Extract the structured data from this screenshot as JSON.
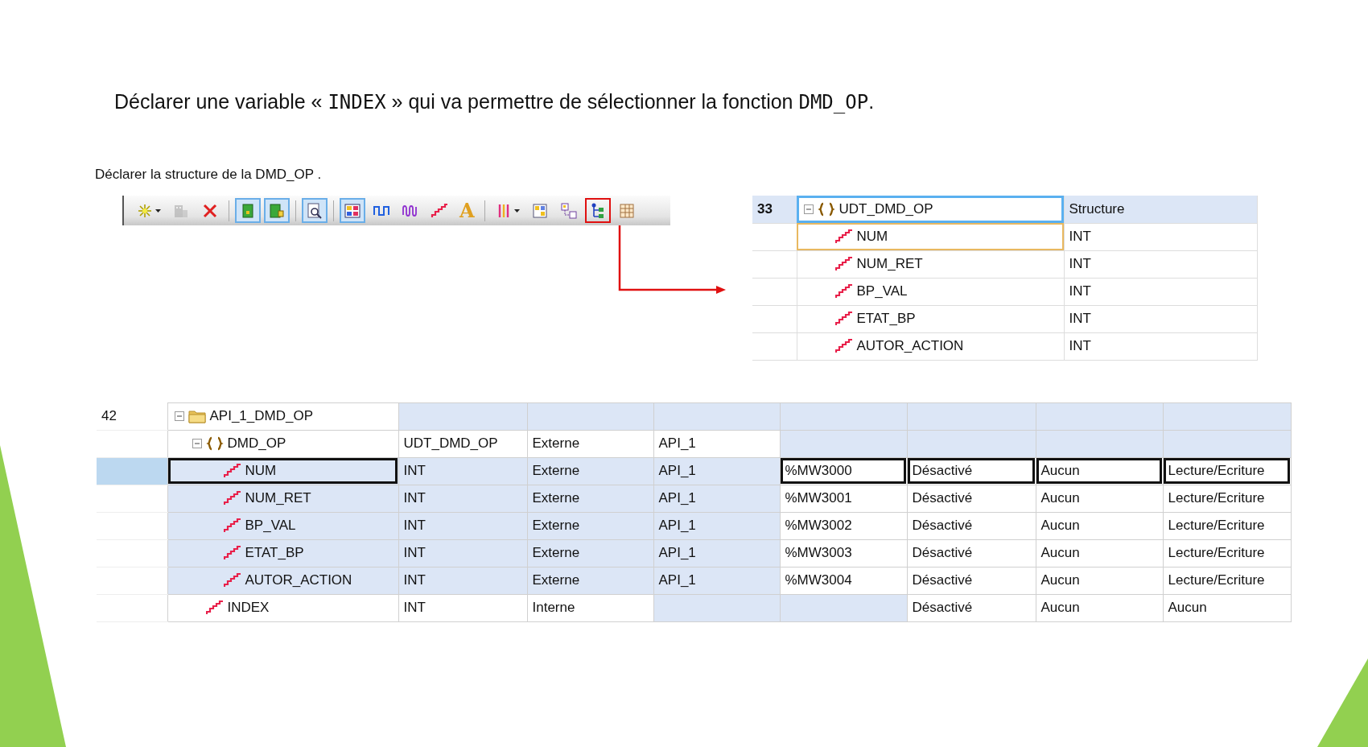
{
  "heading": [
    {
      "kind": "plain",
      "text": "Déclarer une variable « "
    },
    {
      "kind": "code",
      "text": "INDEX"
    },
    {
      "kind": "plain",
      "text": " » qui va permettre de sélectionner la fonction "
    },
    {
      "kind": "code",
      "text": "DMD_OP"
    },
    {
      "kind": "plain",
      "text": "."
    }
  ],
  "subtitle": "Déclarer la structure de la DMD_OP .",
  "toolbar": [
    {
      "kind": "sparkle",
      "pressed": false,
      "caret": true,
      "highlighted": false
    },
    {
      "kind": "building",
      "pressed": false,
      "caret": false,
      "highlighted": false
    },
    {
      "kind": "delete",
      "pressed": false,
      "caret": false,
      "highlighted": false
    },
    {
      "kind": "separator"
    },
    {
      "kind": "green-box",
      "pressed": true,
      "caret": false,
      "highlighted": false
    },
    {
      "kind": "green-box-plug",
      "pressed": true,
      "caret": false,
      "highlighted": false
    },
    {
      "kind": "separator"
    },
    {
      "kind": "magnifier",
      "pressed": true,
      "caret": false,
      "highlighted": false
    },
    {
      "kind": "separator"
    },
    {
      "kind": "color-grid",
      "pressed": true,
      "caret": false,
      "highlighted": false
    },
    {
      "kind": "square-wave",
      "pressed": false,
      "caret": false,
      "highlighted": false
    },
    {
      "kind": "wave",
      "pressed": false,
      "caret": false,
      "highlighted": false
    },
    {
      "kind": "staircase",
      "pressed": false,
      "caret": false,
      "highlighted": false
    },
    {
      "kind": "letter",
      "text": "A",
      "pressed": false,
      "caret": false,
      "highlighted": false
    },
    {
      "kind": "separator"
    },
    {
      "kind": "columns",
      "pressed": false,
      "caret": true,
      "highlighted": false
    },
    {
      "kind": "yellow-grid",
      "pressed": false,
      "caret": false,
      "highlighted": false
    },
    {
      "kind": "hierarchy",
      "pressed": false,
      "caret": false,
      "highlighted": false
    },
    {
      "kind": "tree",
      "pressed": false,
      "caret": false,
      "highlighted": true
    },
    {
      "kind": "table",
      "pressed": false,
      "caret": false,
      "highlighted": false
    }
  ],
  "structure_table": {
    "rows": [
      {
        "number": "33",
        "selected": true,
        "focused": true,
        "hovered": false,
        "kind": "structure",
        "expanded": true,
        "name": "UDT_DMD_OP",
        "type": "Structure",
        "children": [
          {
            "selected": false,
            "focused": false,
            "hovered": true,
            "kind": "variable",
            "name": "NUM",
            "type": "INT"
          },
          {
            "selected": false,
            "focused": false,
            "hovered": false,
            "kind": "variable",
            "name": "NUM_RET",
            "type": "INT"
          },
          {
            "selected": false,
            "focused": false,
            "hovered": false,
            "kind": "variable",
            "name": "BP_VAL",
            "type": "INT"
          },
          {
            "selected": false,
            "focused": false,
            "hovered": false,
            "kind": "variable",
            "name": "ETAT_BP",
            "type": "INT"
          },
          {
            "selected": false,
            "focused": false,
            "hovered": false,
            "kind": "variable",
            "name": "AUTOR_ACTION",
            "type": "INT"
          }
        ]
      }
    ]
  },
  "variable_table": {
    "rows": [
      {
        "number": "42",
        "selected": false,
        "kind": "folder",
        "expanded": true,
        "name": "API_1_DMD_OP",
        "name_shaded": false,
        "cells": [
          {
            "shaded": true
          },
          {
            "shaded": true
          },
          {
            "shaded": true
          },
          {
            "shaded": true
          },
          {
            "shaded": true
          },
          {
            "shaded": true
          },
          {
            "shaded": true
          }
        ],
        "children": [
          {
            "selected": false,
            "kind": "structure",
            "expanded": true,
            "name": "DMD_OP",
            "name_shaded": false,
            "cells": [
              {
                "text": "UDT_DMD_OP",
                "shaded": false
              },
              {
                "text": "Externe",
                "shaded": false
              },
              {
                "text": "API_1",
                "shaded": false
              },
              {
                "shaded": true
              },
              {
                "shaded": true
              },
              {
                "shaded": true
              },
              {
                "shaded": true
              }
            ],
            "children": [
              {
                "selected": true,
                "kind": "variable",
                "name": "NUM",
                "name_shaded": true,
                "cells": [
                  {
                    "text": "INT",
                    "shaded": true
                  },
                  {
                    "text": "Externe",
                    "shaded": true
                  },
                  {
                    "text": "API_1",
                    "shaded": true
                  },
                  {
                    "text": "%MW3000",
                    "shaded": false
                  },
                  {
                    "text": "Désactivé",
                    "shaded": false
                  },
                  {
                    "text": "Aucun",
                    "shaded": false
                  },
                  {
                    "text": "Lecture/Ecriture",
                    "shaded": false
                  }
                ]
              },
              {
                "selected": false,
                "kind": "variable",
                "name": "NUM_RET",
                "name_shaded": true,
                "cells": [
                  {
                    "text": "INT",
                    "shaded": true
                  },
                  {
                    "text": "Externe",
                    "shaded": true
                  },
                  {
                    "text": "API_1",
                    "shaded": true
                  },
                  {
                    "text": "%MW3001",
                    "shaded": false
                  },
                  {
                    "text": "Désactivé",
                    "shaded": false
                  },
                  {
                    "text": "Aucun",
                    "shaded": false
                  },
                  {
                    "text": "Lecture/Ecriture",
                    "shaded": false
                  }
                ]
              },
              {
                "selected": false,
                "kind": "variable",
                "name": "BP_VAL",
                "name_shaded": true,
                "cells": [
                  {
                    "text": "INT",
                    "shaded": true
                  },
                  {
                    "text": "Externe",
                    "shaded": true
                  },
                  {
                    "text": "API_1",
                    "shaded": true
                  },
                  {
                    "text": "%MW3002",
                    "shaded": false
                  },
                  {
                    "text": "Désactivé",
                    "shaded": false
                  },
                  {
                    "text": "Aucun",
                    "shaded": false
                  },
                  {
                    "text": "Lecture/Ecriture",
                    "shaded": false
                  }
                ]
              },
              {
                "selected": false,
                "kind": "variable",
                "name": "ETAT_BP",
                "name_shaded": true,
                "cells": [
                  {
                    "text": "INT",
                    "shaded": true
                  },
                  {
                    "text": "Externe",
                    "shaded": true
                  },
                  {
                    "text": "API_1",
                    "shaded": true
                  },
                  {
                    "text": "%MW3003",
                    "shaded": false
                  },
                  {
                    "text": "Désactivé",
                    "shaded": false
                  },
                  {
                    "text": "Aucun",
                    "shaded": false
                  },
                  {
                    "text": "Lecture/Ecriture",
                    "shaded": false
                  }
                ]
              },
              {
                "selected": false,
                "kind": "variable",
                "name": "AUTOR_ACTION",
                "name_shaded": true,
                "cells": [
                  {
                    "text": "INT",
                    "shaded": true
                  },
                  {
                    "text": "Externe",
                    "shaded": true
                  },
                  {
                    "text": "API_1",
                    "shaded": true
                  },
                  {
                    "text": "%MW3004",
                    "shaded": false
                  },
                  {
                    "text": "Désactivé",
                    "shaded": false
                  },
                  {
                    "text": "Aucun",
                    "shaded": false
                  },
                  {
                    "text": "Lecture/Ecriture",
                    "shaded": false
                  }
                ]
              }
            ]
          },
          {
            "selected": false,
            "kind": "variable",
            "name": "INDEX",
            "name_shaded": false,
            "cells": [
              {
                "text": "INT",
                "shaded": false
              },
              {
                "text": "Interne",
                "shaded": false
              },
              {
                "shaded": true
              },
              {
                "shaded": true
              },
              {
                "text": "Désactivé",
                "shaded": false
              },
              {
                "text": "Aucun",
                "shaded": false
              },
              {
                "text": "Aucun",
                "shaded": false
              }
            ]
          }
        ]
      }
    ]
  }
}
